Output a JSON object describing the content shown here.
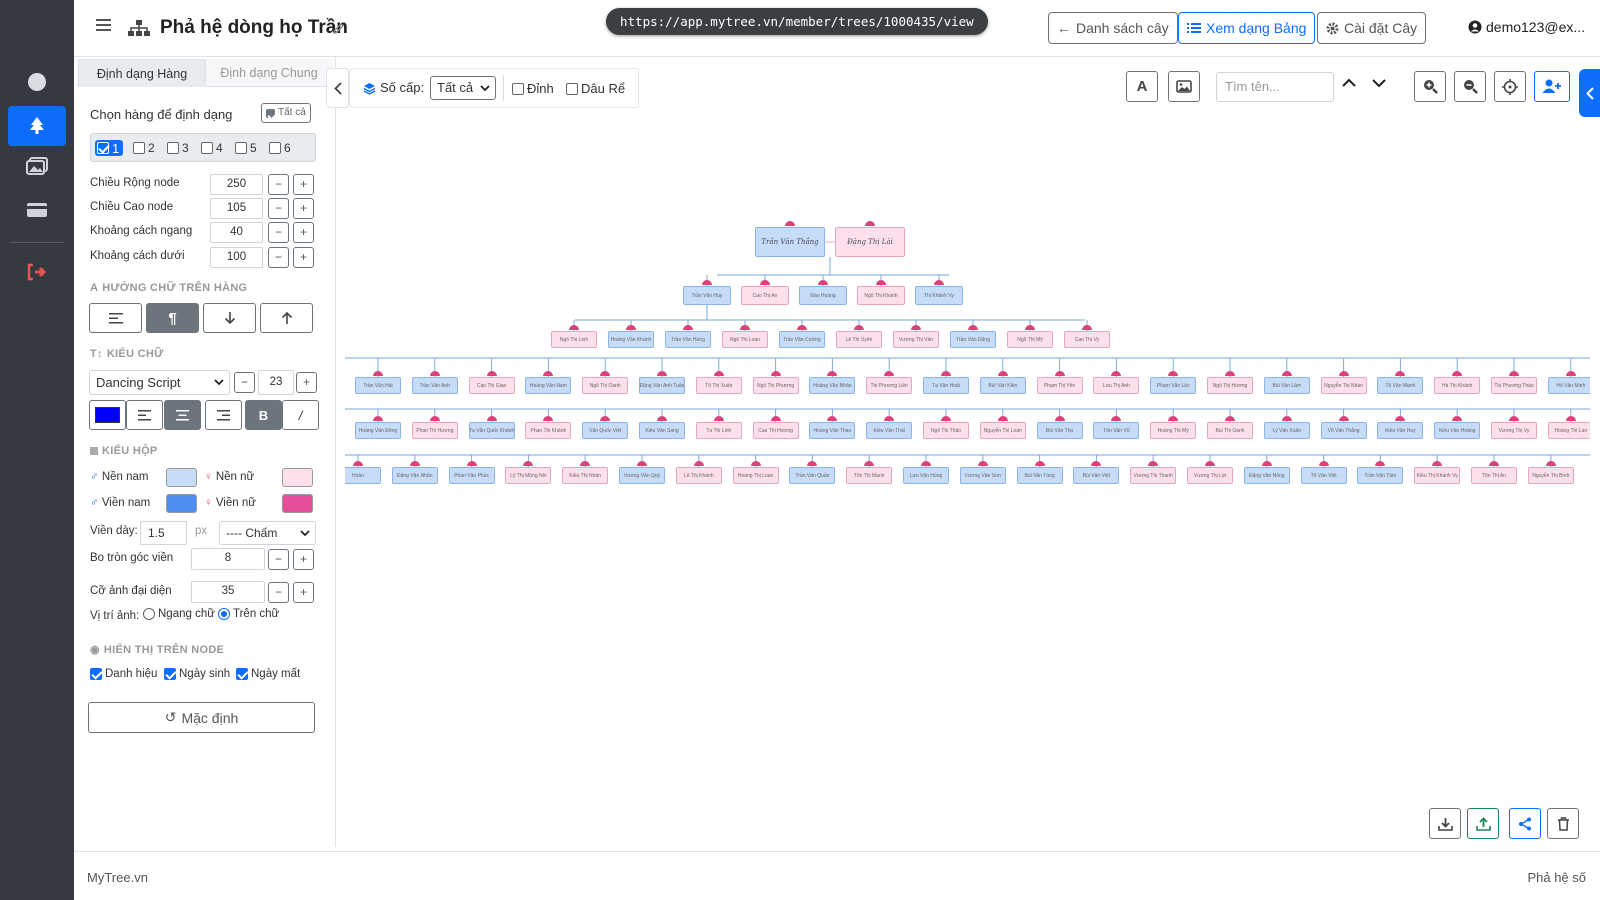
{
  "app": {
    "brand": "MyTree.vn",
    "footer_right": "Phả hệ số"
  },
  "header": {
    "title": "Phả hệ dòng họ Trần",
    "url": "https://app.mytree.vn/member/trees/1000435/view",
    "btn_list": "Danh sách cây",
    "btn_table": "Xem dạng Bảng",
    "btn_settings": "Cài đặt Cây",
    "user": "demo123@ex..."
  },
  "panel": {
    "tab_rows": "Định dạng Hàng",
    "tab_general": "Định dạng Chung",
    "choose_rows": "Chọn hàng để định dạng",
    "all_btn": "Tất cả",
    "rows": [
      "1",
      "2",
      "3",
      "4",
      "5",
      "6"
    ],
    "width_label": "Chiều Rộng node",
    "width_val": "250",
    "height_label": "Chiều Cao node",
    "height_val": "105",
    "hgap_label": "Khoảng cách ngang",
    "hgap_val": "40",
    "vgap_label": "Khoảng cách dưới",
    "vgap_val": "100",
    "dir_section": "HƯỚNG CHỮ TRÊN HÀNG",
    "font_section": "KIỂU CHỮ",
    "font_family": "Dancing Script",
    "font_size": "23",
    "font_color": "#0000ff",
    "bold_label": "B",
    "italic_label": "/",
    "box_section": "KIỂU HỘP",
    "male_bg": "Nền nam",
    "female_bg": "Nền nữ",
    "male_border": "Viền nam",
    "female_border": "Viền nữ",
    "male_bg_color": "#c6dcf8",
    "female_bg_color": "#fde0ec",
    "male_border_color": "#4d8ef0",
    "female_border_color": "#e84d9a",
    "border_width_label": "Viền dày:",
    "border_width_val": "1.5",
    "px": "px",
    "border_style": "---- Chấm",
    "radius_label": "Bo tròn góc viền",
    "radius_val": "8",
    "avatar_label": "Cỡ ảnh đại diện",
    "avatar_val": "35",
    "img_pos_label": "Vị trí ảnh:",
    "img_pos_side": "Ngang chữ",
    "img_pos_top": "Trên chữ",
    "display_section": "HIỂN THỊ TRÊN NODE",
    "show_title": "Danh hiệu",
    "show_birth": "Ngày sinh",
    "show_death": "Ngày mất",
    "reset": "Mặc định"
  },
  "toolbar": {
    "levels_label": "Số cấp:",
    "levels_val": "Tất cả",
    "top_label": "Đỉnh",
    "root_label": "Dâu Rể",
    "search_placeholder": "Tìm tên..."
  },
  "tree": {
    "gen1": [
      "Trần Văn Thắng",
      "Đặng Thị Lài"
    ],
    "gen2": [
      "Trần Văn Huy",
      "Cao Thị An",
      "Đào Hoàng",
      "Ngô Thị Khánh",
      "Thi Khánh Vy"
    ],
    "gen3": [
      "Ngô Thị Linh",
      "Hoàng Văn Khánh",
      "Trần Văn Hùng",
      "Ngô Thị Loan",
      "Trần Văn Cường",
      "Lê Thị Uyên",
      "Vương Thị Vân",
      "Trần Văn Dũng",
      "Ngô Thị Mỹ",
      "Cao Thị Vy"
    ],
    "gen4": [
      "Trần Văn Hải",
      "Trần Văn Anh",
      "Cao Thị Giao",
      "Hoàng Văn Nam",
      "Ngô Thị Oanh",
      "Đặng Văn Anh Tuấn",
      "Tô Thị Xuân",
      "Ngô Thị Phương",
      "Hoàng Văn Nhân",
      "Thị Phương Liên",
      "Tạ Văn Hoài",
      "Bùi Văn Kiên",
      "Phạm Thị Yến",
      "Lưu Thị Anh",
      "Phạm Văn Lộc",
      "Ngô Thị Hương",
      "Bùi Văn Lâm",
      "Nguyễn Thị Nhàn",
      "Tô Văn Mạnh",
      "Hà Thị Khánh",
      "Thị Phương Thảo",
      "Hồ Văn Minh"
    ],
    "gen5": [
      "Hoàng Văn Đông",
      "Phan Thị Hương",
      "Tạ Văn Quốc Khánh",
      "Phan Thị Khánh",
      "Văn Quốc Việt",
      "Kiều Văn Sang",
      "Tạ Thị Linh",
      "Cao Thị Hương",
      "Hoàng Văn Thao",
      "Kiều Văn Thái",
      "Ngô Thị Thảo",
      "Nguyễn Thị Loan",
      "Bùi Văn Thụ",
      "Tôn Văn Vũ",
      "Hoàng Thị Mỹ",
      "Bùi Thị Oanh",
      "Lý Văn Xuân",
      "Võ Văn Thắng",
      "Kiều Văn Huy",
      "Kiều Văn Hoàng",
      "Vương Thị Vy",
      "Hoàng Thị Lan"
    ],
    "gen6": [
      "Hoàn",
      "Đặng Văn Nhân",
      "Phan Văn Phúc",
      "Lý Thị Mộng Nhi",
      "Kiều Thị Nhàn",
      "Vương Văn Quý",
      "Lê Thị Khánh",
      "Hoàng Thị Loan",
      "Trần Văn Quân",
      "Tôn Thị Mạnh",
      "Lưu Văn Hùng",
      "Vương Văn Sơn",
      "Bùi Văn Tùng",
      "Bùi Văn Việt",
      "Vương Thị Thanh",
      "Vương Thị Lợi",
      "Đặng Văn Nông",
      "Tô Văn Việt",
      "Trần Văn Tâm",
      "Kiều Thị Khánh Vy",
      "Tôn Thị An",
      "Nguyễn Thị Bình"
    ]
  }
}
